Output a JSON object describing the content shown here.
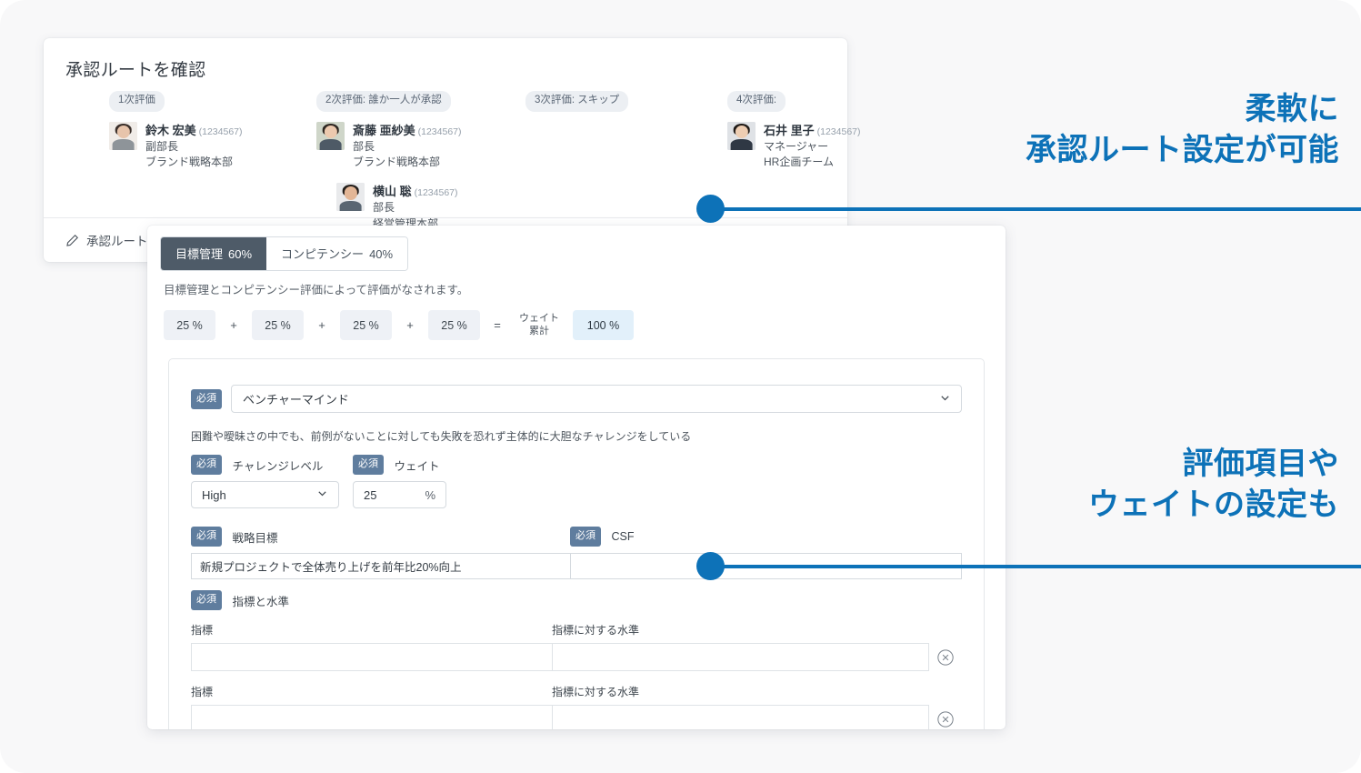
{
  "approval_card": {
    "title": "承認ルートを確認",
    "stages": [
      {
        "badge": "1次評価",
        "people": [
          {
            "name": "鈴木 宏美",
            "id": "(1234567)",
            "title": "副部長",
            "org": "ブランド戦略本部",
            "avatar": {
              "bg": "#f0ece8",
              "hair": "#3a2f2a",
              "skin": "#e7c4ab",
              "body": "#8e9499"
            }
          }
        ]
      },
      {
        "badge": "2次評価: 誰か一人が承認",
        "people": [
          {
            "name": "斎藤 亜紗美",
            "id": "(1234567)",
            "title": "部長",
            "org": "ブランド戦略本部",
            "avatar": {
              "bg": "#cfd6c9",
              "hair": "#2e2722",
              "skin": "#ecc9ae",
              "body": "#4e5a66"
            }
          },
          {
            "name": "横山 聡",
            "id": "(1234567)",
            "title": "部長",
            "org": "経営管理本部",
            "avatar": {
              "bg": "#e9eaec",
              "hair": "#241f1c",
              "skin": "#e3b696",
              "body": "#5a6672"
            }
          }
        ]
      },
      {
        "badge": "3次評価: スキップ",
        "people": []
      },
      {
        "badge": "4次評価:",
        "people": [
          {
            "name": "石井 里子",
            "id": "(1234567)",
            "title": "マネージャー",
            "org": "HR企画チーム",
            "avatar": {
              "bg": "#dfe2e6",
              "hair": "#201b18",
              "skin": "#edcdb2",
              "body": "#2f3844"
            }
          }
        ]
      }
    ],
    "edit_link": "承認ルートの"
  },
  "form_card": {
    "tabs": [
      {
        "label": "目標管理",
        "pct": "60%",
        "active": true
      },
      {
        "label": "コンピテンシー",
        "pct": "40%",
        "active": false
      }
    ],
    "description": "目標管理とコンピテンシー評価によって評価がなされます。",
    "weights": {
      "values": [
        "25 %",
        "25 %",
        "25 %",
        "25 %"
      ],
      "operator": "+",
      "equals": "=",
      "total_label_line1": "ウェイト",
      "total_label_line2": "累計",
      "total": "100 %"
    },
    "item": {
      "required_badge": "必須",
      "selected": "ベンチャーマインド",
      "description": "困難や曖昧さの中でも、前例がないことに対しても失敗を恐れず主体的に大胆なチャレンジをしている",
      "challenge_level_label": "チャレンジレベル",
      "challenge_level_value": "High",
      "weight_label": "ウェイト",
      "weight_value": "25",
      "weight_unit": "%",
      "goal_label": "戦略目標",
      "goal_value": "新規プロジェクトで全体売り上げを前年比20%向上",
      "csf_label": "CSF",
      "csf_value": "",
      "indicators_label": "指標と水準",
      "indicator_rows": [
        {
          "left_label": "指標",
          "right_label": "指標に対する水準",
          "left_value": "",
          "right_value": ""
        },
        {
          "left_label": "指標",
          "right_label": "指標に対する水準",
          "left_value": "",
          "right_value": ""
        }
      ]
    }
  },
  "callouts": {
    "one_line1": "柔軟に",
    "one_line2": "承認ルート設定が可能",
    "two_line1": "評価項目や",
    "two_line2": "ウェイトの設定も",
    "accent_color": "#0d72b8"
  }
}
